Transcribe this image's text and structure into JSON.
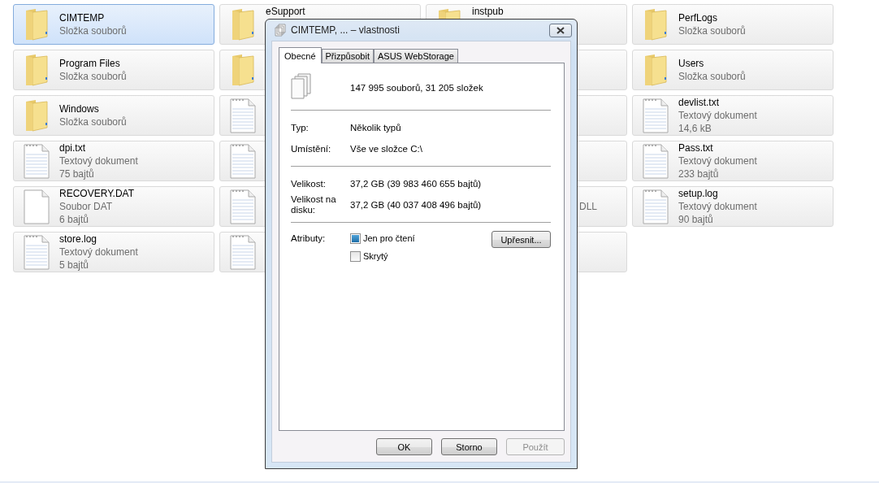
{
  "tiles": [
    {
      "kind": "folder",
      "name": "CIMTEMP",
      "lines": [
        "Složka souborů"
      ],
      "selected": true
    },
    {
      "kind": "folder",
      "name": "eSupport",
      "selected": false
    },
    {
      "kind": "folder",
      "name": "instpub",
      "selected": false
    },
    {
      "kind": "folder",
      "name": "PerfLogs",
      "lines": [
        "Složka souborů"
      ],
      "selected": false
    },
    {
      "kind": "folder",
      "name": "Program Files",
      "lines": [
        "Složka souborů"
      ],
      "selected": false
    },
    {
      "kind": "folder",
      "selected": false
    },
    {
      "kind": "hidden",
      "selected": false
    },
    {
      "kind": "folder",
      "name": "Users",
      "lines": [
        "Složka souborů"
      ],
      "selected": false
    },
    {
      "kind": "folder",
      "name": "Windows",
      "lines": [
        "Složka souborů"
      ],
      "selected": false
    },
    {
      "kind": "text",
      "selected": false
    },
    {
      "kind": "hidden",
      "selected": false
    },
    {
      "kind": "text",
      "name": "devlist.txt",
      "lines": [
        "Textový dokument",
        "14,6 kB"
      ],
      "selected": false
    },
    {
      "kind": "text",
      "name": "dpi.txt",
      "lines": [
        "Textový dokument",
        "75 bajtů"
      ],
      "selected": false
    },
    {
      "kind": "text",
      "selected": false
    },
    {
      "kind": "hidden",
      "selected": false
    },
    {
      "kind": "text",
      "name": "Pass.txt",
      "lines": [
        "Textový dokument",
        "233 bajtů"
      ],
      "selected": false
    },
    {
      "kind": "file",
      "name": "RECOVERY.DAT",
      "lines": [
        "Soubor DAT",
        "6 bajtů"
      ],
      "selected": false
    },
    {
      "kind": "text",
      "selected": false
    },
    {
      "kind": "hidden",
      "lines": [
        "DLL"
      ],
      "cut": true,
      "selected": false
    },
    {
      "kind": "text",
      "name": "setup.log",
      "lines": [
        "Textový dokument",
        "90 bajtů"
      ],
      "selected": false
    },
    {
      "kind": "text",
      "name": "store.log",
      "lines": [
        "Textový dokument",
        "5 bajtů"
      ],
      "selected": false
    },
    {
      "kind": "text",
      "selected": false
    },
    {
      "kind": "hidden",
      "selected": false
    }
  ],
  "dialog": {
    "title": "CIMTEMP, ... – vlastnosti",
    "tabs": [
      {
        "label": "Obecné",
        "selected": true
      },
      {
        "label": "Přizpůsobit",
        "selected": false
      },
      {
        "label": "ASUS WebStorage",
        "selected": false
      }
    ],
    "summary": "147 995 souborů, 31 205 složek",
    "property_groups": [
      {
        "properties": [
          {
            "label": "Typ:",
            "value": "Několik typů"
          },
          {
            "label": "Umístění:",
            "value": "Vše ve složce C:\\"
          }
        ]
      },
      {
        "properties": [
          {
            "label": "Velikost:",
            "value": "37,2 GB (39 983 460 655 bajtů)"
          },
          {
            "label": "Velikost na disku:",
            "value": "37,2 GB (40 037 408 496 bajtů)"
          }
        ]
      }
    ],
    "attributes": {
      "label": "Atributy:",
      "checkboxes": [
        {
          "label": "Jen pro čtení",
          "checked": true
        },
        {
          "label": "Skrytý",
          "checked": false
        }
      ],
      "button": "Upřesnit..."
    },
    "buttons": [
      {
        "label": "OK",
        "disabled": false
      },
      {
        "label": "Storno",
        "disabled": false
      },
      {
        "label": "Použít",
        "disabled": true
      }
    ]
  }
}
